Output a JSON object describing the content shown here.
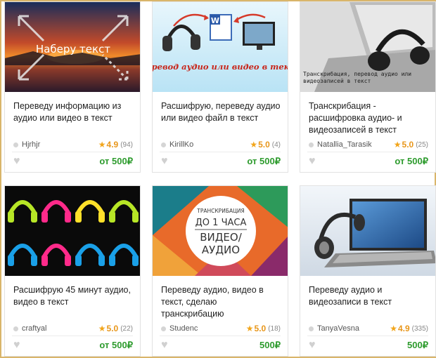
{
  "currency": "₽",
  "cards": [
    {
      "thumb_text": "Наберу текст",
      "title": "Переведу информацию из аудио или видео в текст",
      "seller": "Hjrhjr",
      "rating": "4.9",
      "reviews": "(94)",
      "price_prefix": "от",
      "price": "500₽"
    },
    {
      "thumb_text": "Перевод аудио или видео в текст",
      "thumb_badge": "W",
      "title": "Расшифрую, переведу аудио или видео файл в текст",
      "seller": "KirillKo",
      "rating": "5.0",
      "reviews": "(4)",
      "price_prefix": "от",
      "price": "500₽"
    },
    {
      "thumb_text": "Транскрибация, перевод аудио или видеозаписей в текст",
      "title": "Транскрибация - расшифровка аудио- и видеозаписей в текст",
      "seller": "Natallia_Tarasik",
      "rating": "5.0",
      "reviews": "(25)",
      "price_prefix": "от",
      "price": "500₽"
    },
    {
      "title": "Расшифрую 45 минут аудио, видео в текст",
      "seller": "craftyal",
      "rating": "5.0",
      "reviews": "(22)",
      "price_prefix": "от",
      "price": "500₽"
    },
    {
      "thumb_line1": "ТРАНСКРИБАЦИЯ",
      "thumb_line2": "ДО 1 ЧАСА",
      "thumb_line3": "ВИДЕО/",
      "thumb_line4": "АУДИО",
      "title": "Переведу аудио, видео в текст, сделаю транскрибацию",
      "seller": "Studenc",
      "rating": "5.0",
      "reviews": "(18)",
      "price_prefix": "",
      "price": "500₽"
    },
    {
      "title": "Переведу аудио и видеозаписи в текст",
      "seller": "TanyaVesna",
      "rating": "4.9",
      "reviews": "(335)",
      "price_prefix": "",
      "price": "500₽"
    }
  ],
  "colors": {
    "price_green": "#2d9b2d",
    "star_orange": "#f2a51a",
    "frame_gold": "#d9b56a"
  }
}
